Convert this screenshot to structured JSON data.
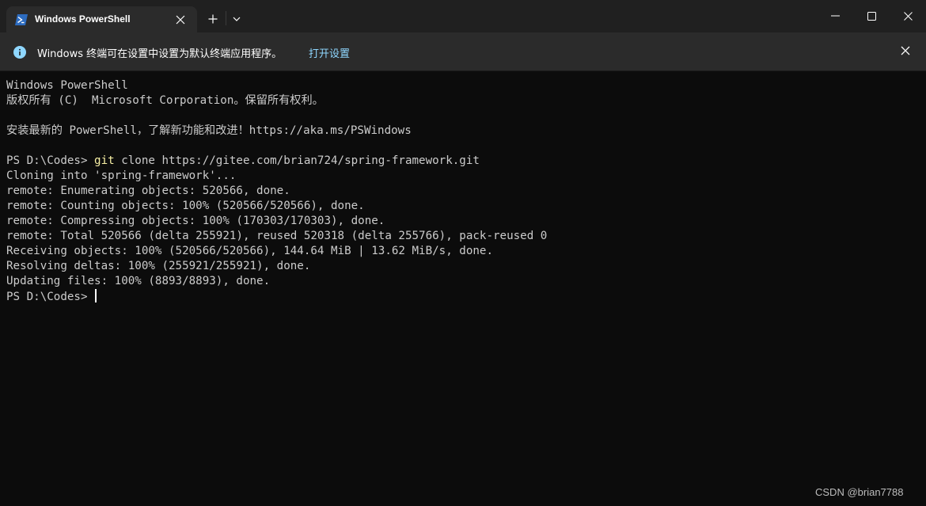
{
  "titlebar": {
    "tab_title": "Windows PowerShell",
    "icons": {
      "tab": "powershell-icon",
      "tab_close": "close-icon",
      "new_tab": "plus-icon",
      "dropdown": "chevron-down-icon",
      "minimize": "minimize-icon",
      "maximize": "maximize-icon",
      "close": "close-icon"
    }
  },
  "infobar": {
    "message": "Windows 终端可在设置中设置为默认终端应用程序。",
    "link": "打开设置",
    "icons": {
      "info": "info-icon",
      "close": "close-icon"
    }
  },
  "terminal": {
    "lines": [
      "Windows PowerShell",
      "版权所有 (C)  Microsoft Corporation。保留所有权利。",
      "",
      "安装最新的 PowerShell，了解新功能和改进！https://aka.ms/PSWindows",
      "",
      {
        "prompt": "PS D:\\Codes> ",
        "command": "git",
        "args": " clone https://gitee.com/brian724/spring-framework.git"
      },
      "Cloning into 'spring-framework'...",
      "remote: Enumerating objects: 520566, done.",
      "remote: Counting objects: 100% (520566/520566), done.",
      "remote: Compressing objects: 100% (170303/170303), done.",
      "remote: Total 520566 (delta 255921), reused 520318 (delta 255766), pack-reused 0",
      "Receiving objects: 100% (520566/520566), 144.64 MiB | 13.62 MiB/s, done.",
      "Resolving deltas: 100% (255921/255921), done.",
      "Updating files: 100% (8893/8893), done."
    ],
    "current_prompt": "PS D:\\Codes> "
  },
  "watermark": "CSDN @brian7788",
  "colors": {
    "background": "#0c0c0c",
    "titlebar": "#202020",
    "tab": "#2b2b2b",
    "text": "#cccccc",
    "command": "#f9f1a5",
    "link": "#8fd7ff",
    "info_icon": "#8fd7ff"
  }
}
